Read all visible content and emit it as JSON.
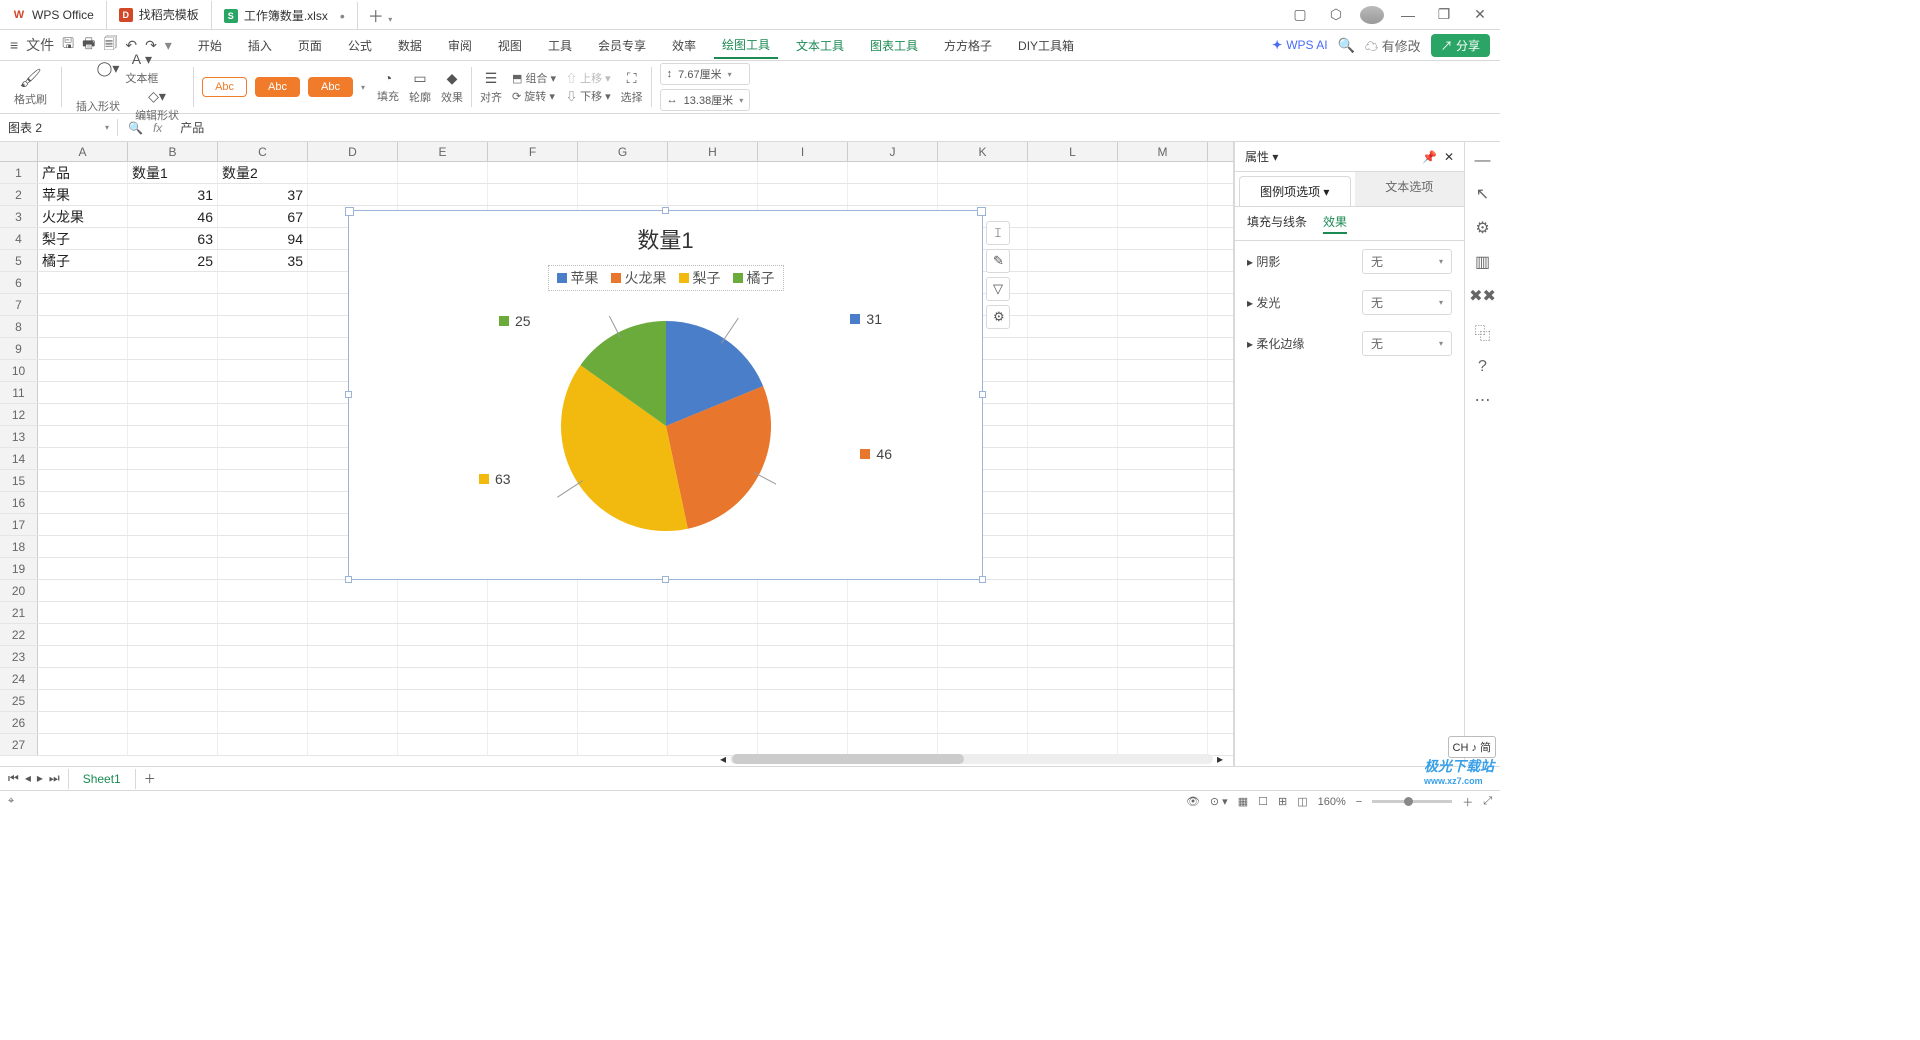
{
  "titlebar": {
    "tab1": "WPS Office",
    "tab2": "找稻壳模板",
    "tab3": "工作簿数量.xlsx"
  },
  "quick": {
    "file": "文件"
  },
  "menu": {
    "m1": "开始",
    "m2": "插入",
    "m3": "页面",
    "m4": "公式",
    "m5": "数据",
    "m6": "审阅",
    "m7": "视图",
    "m8": "工具",
    "m9": "会员专享",
    "m10": "效率",
    "m11": "绘图工具",
    "m12": "文本工具",
    "m13": "图表工具",
    "m14": "方方格子",
    "m15": "DIY工具箱"
  },
  "menu_right": {
    "ai": "WPS AI",
    "edit": "有修改",
    "share": "分享"
  },
  "ribbon": {
    "format_painter": "格式刷",
    "insert_shape": "插入形状",
    "edit_shape": "编辑形状",
    "text_box": "文本框",
    "abc1": "Abc",
    "abc2": "Abc",
    "abc3": "Abc",
    "fill": "填充",
    "outline": "轮廓",
    "effect": "效果",
    "align": "对齐",
    "group": "组合",
    "rotate": "旋转",
    "up": "上移",
    "down": "下移",
    "select": "选择",
    "width": "7.67厘米",
    "height": "13.38厘米"
  },
  "formula": {
    "name": "图表 2",
    "content": "产品"
  },
  "columns": [
    "A",
    "B",
    "C",
    "D",
    "E",
    "F",
    "G",
    "H",
    "I",
    "J",
    "K",
    "L",
    "M"
  ],
  "table": {
    "header": [
      "产品",
      "数量1",
      "数量2"
    ],
    "rows": [
      [
        "苹果",
        "31",
        "37"
      ],
      [
        "火龙果",
        "46",
        "67"
      ],
      [
        "梨子",
        "63",
        "94"
      ],
      [
        "橘子",
        "25",
        "35"
      ]
    ]
  },
  "chart_data": {
    "type": "pie",
    "title": "数量1",
    "categories": [
      "苹果",
      "火龙果",
      "梨子",
      "橘子"
    ],
    "values": [
      31,
      46,
      63,
      25
    ],
    "data_labels": [
      31,
      46,
      63,
      25
    ],
    "colors": [
      "#4a7ec8",
      "#e8762c",
      "#f2b90e",
      "#6aab3c"
    ],
    "legend_position": "top"
  },
  "right_panel": {
    "title": "属性",
    "tab_a": "图例项选项",
    "tab_b": "文本选项",
    "sub_a": "填充与线条",
    "sub_b": "效果",
    "shadow": "阴影",
    "glow": "发光",
    "soft": "柔化边缘",
    "none": "无"
  },
  "sheet": {
    "name": "Sheet1"
  },
  "status": {
    "zoom": "160%",
    "ime": "CH ♪ 简"
  },
  "watermark": {
    "big": "极光下载站",
    "small": "www.xz7.com"
  }
}
